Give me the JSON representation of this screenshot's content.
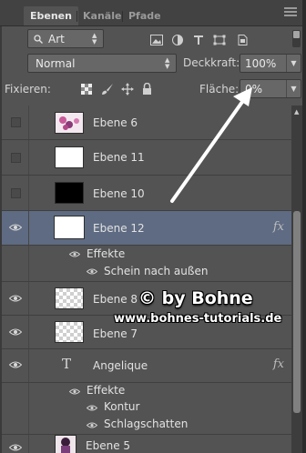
{
  "tabs": [
    {
      "label": "Ebenen",
      "active": true
    },
    {
      "label": "Kanäle",
      "active": false
    },
    {
      "label": "Pfade",
      "active": false
    }
  ],
  "filter": {
    "kind_label": "Art",
    "icons": [
      "image-filter-icon",
      "adjustment-filter-icon",
      "type-filter-icon",
      "shape-filter-icon",
      "smart-object-filter-icon"
    ]
  },
  "blend": {
    "mode": "Normal",
    "opacity_label": "Deckkraft:",
    "opacity_value": "100%"
  },
  "lock": {
    "label": "Fixieren:",
    "fill_label": "Fläche:",
    "fill_value": "0%"
  },
  "layers": [
    {
      "name": "Ebene 6",
      "visible": false
    },
    {
      "name": "Ebene 11",
      "visible": false
    },
    {
      "name": "Ebene 10",
      "visible": false
    },
    {
      "name": "Ebene 12",
      "visible": true,
      "selected": true,
      "fx": "fx"
    },
    {
      "effects_label": "Effekte",
      "effect": "Schein nach außen"
    },
    {
      "name": "Ebene 8",
      "visible": true
    },
    {
      "name": "Ebene 7",
      "visible": true
    },
    {
      "name": "Angelique",
      "visible": true,
      "type": "T",
      "fx": "fx"
    },
    {
      "effects_label": "Effekte",
      "effects": [
        "Kontur",
        "Schlagschatten"
      ]
    },
    {
      "name": "Ebene 5",
      "visible": true
    }
  ],
  "watermark": {
    "line1": "© by Bohne",
    "line2": "www.bohnes-tutorials.de"
  },
  "colors": {
    "panel": "#535353",
    "tabbar": "#424242",
    "selected_row": "#5e6b82",
    "control": "#676767"
  }
}
